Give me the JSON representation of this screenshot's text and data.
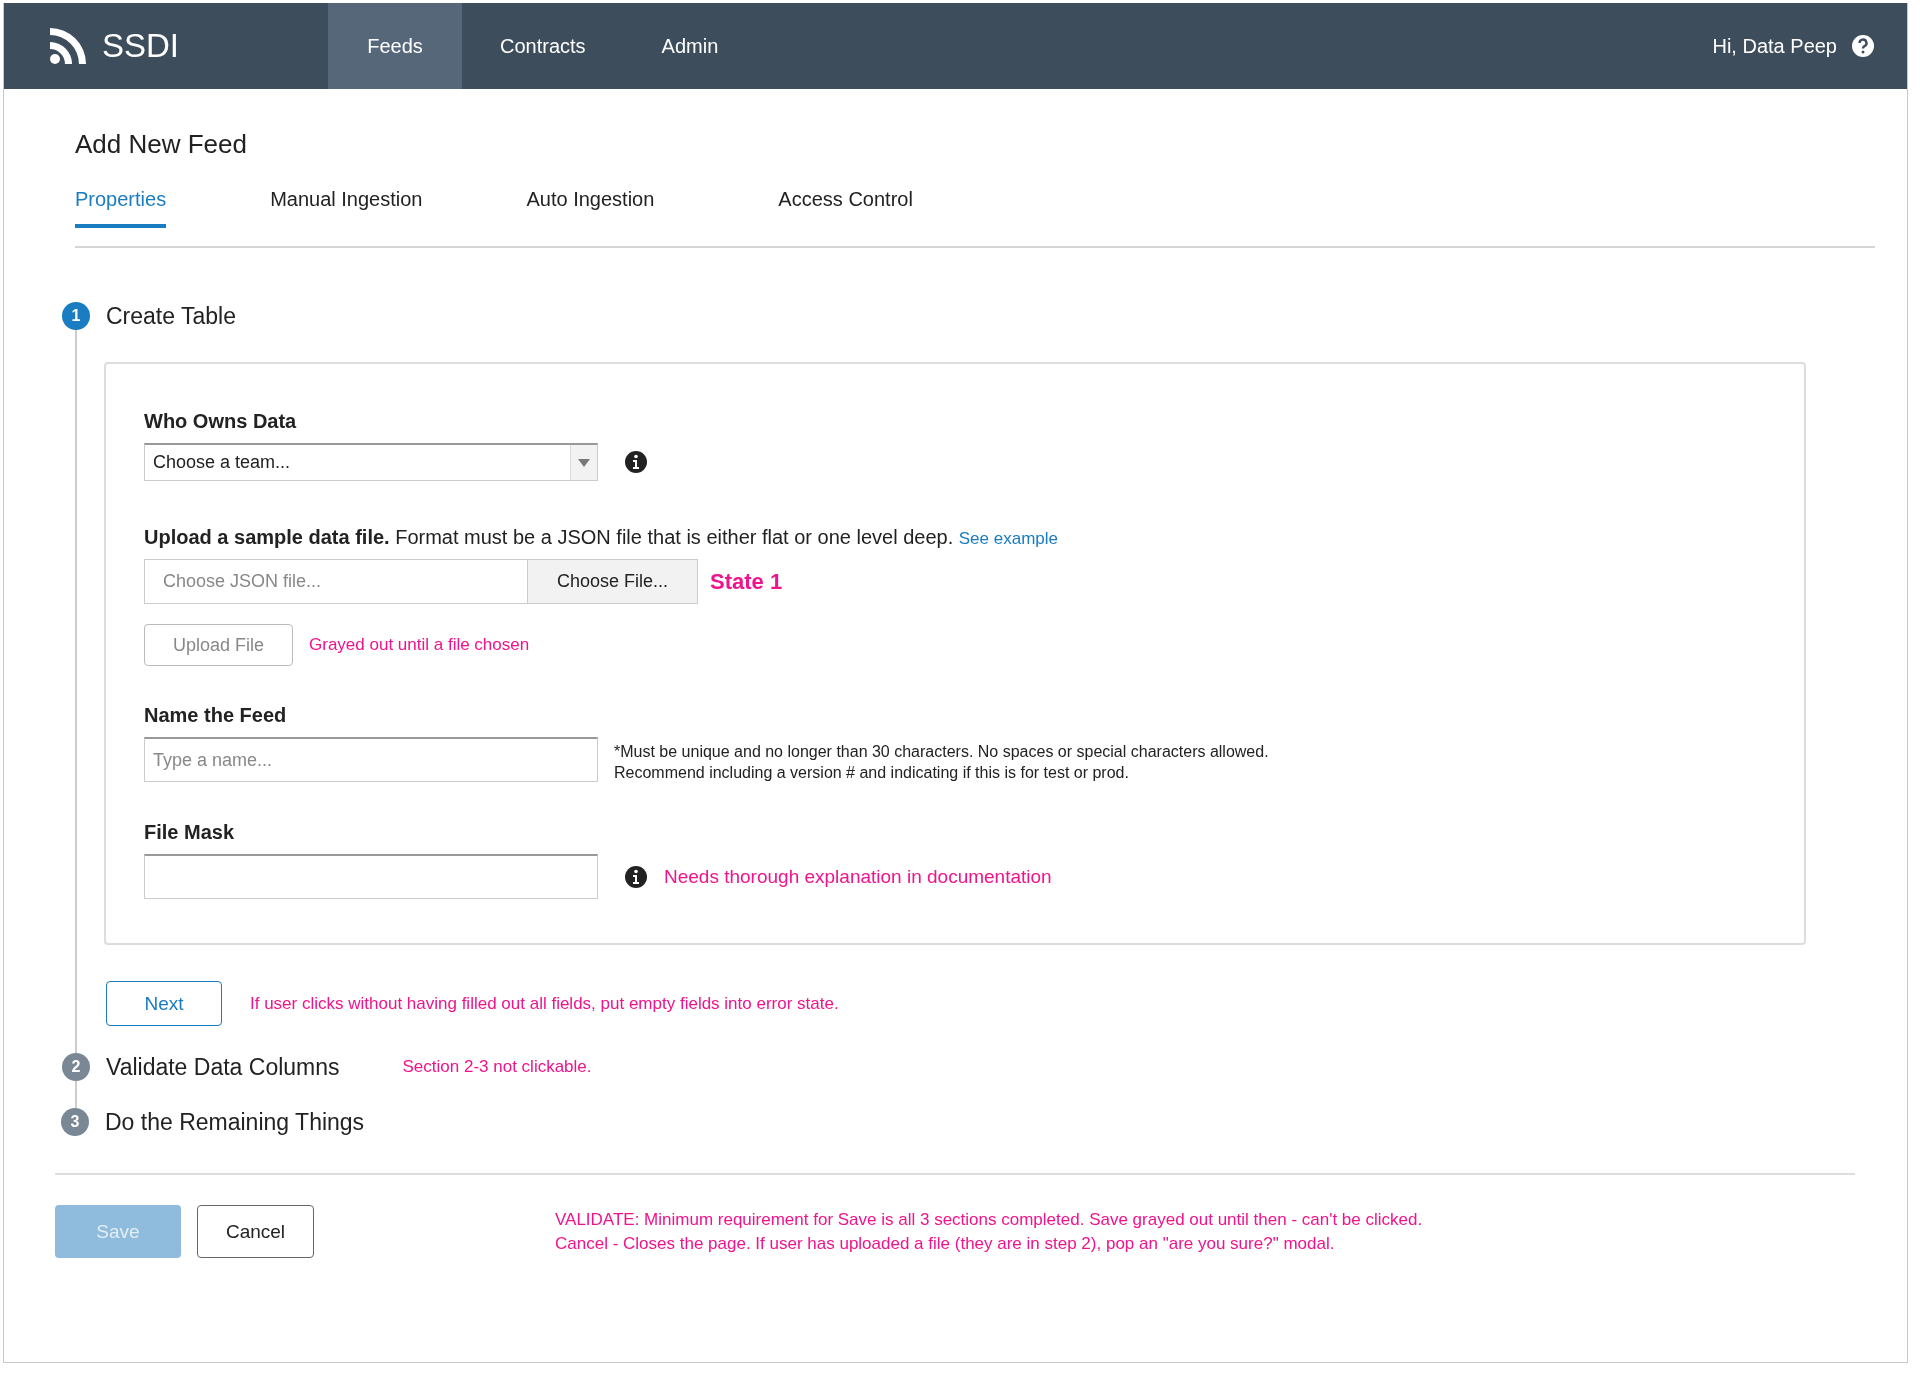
{
  "header": {
    "logo_text": "SSDI",
    "nav": [
      {
        "label": "Feeds",
        "selected": true
      },
      {
        "label": "Contracts",
        "selected": false
      },
      {
        "label": "Admin",
        "selected": false
      }
    ],
    "greeting": "Hi, Data Peep"
  },
  "page_title": "Add New Feed",
  "tabs": [
    {
      "label": "Properties",
      "selected": true
    },
    {
      "label": "Manual Ingestion",
      "selected": false
    },
    {
      "label": "Auto Ingestion",
      "selected": false
    },
    {
      "label": "Access Control",
      "selected": false
    }
  ],
  "steps": [
    {
      "number": "1",
      "title": "Create Table",
      "active": true
    },
    {
      "number": "2",
      "title": "Validate Data Columns",
      "active": false,
      "note": "Section 2-3 not clickable."
    },
    {
      "number": "3",
      "title": "Do the Remaining Things",
      "active": false
    }
  ],
  "form": {
    "who_owns": {
      "label": "Who Owns Data",
      "value": "Choose a team..."
    },
    "upload": {
      "text": "**Upload a sample data file.** Format must be a JSON file that is either flat or one level deep.",
      "link": "See example",
      "placeholder": "Choose JSON file...",
      "choose_button": "Choose File...",
      "state_note": "State 1",
      "upload_button": {
        "label": "Upload File",
        "disabled": true
      },
      "note": "Grayed out until a file chosen"
    },
    "feed_name": {
      "label": "Name the Feed",
      "placeholder": "Type a name...",
      "hint_lines": [
        "*Must be unique and no longer than 30 characters. No spaces or special characters allowed.",
        "Recommend including a version # and indicating if this is for test or prod."
      ]
    },
    "file_mask": {
      "label": "File Mask",
      "note": "Needs thorough explanation in documentation"
    }
  },
  "next": {
    "label": "Next",
    "note": "If user clicks without having filled out all fields, put empty fields into error state."
  },
  "footer": {
    "save": {
      "label": "Save",
      "disabled": true
    },
    "cancel": {
      "label": "Cancel"
    },
    "notes": [
      "VALIDATE: Minimum requirement for Save is all 3 sections completed. Save grayed out until then - can't be clicked.",
      "Cancel - Closes the page. If user has uploaded a file (they are in step 2), pop an \"are you sure?\" modal."
    ]
  }
}
